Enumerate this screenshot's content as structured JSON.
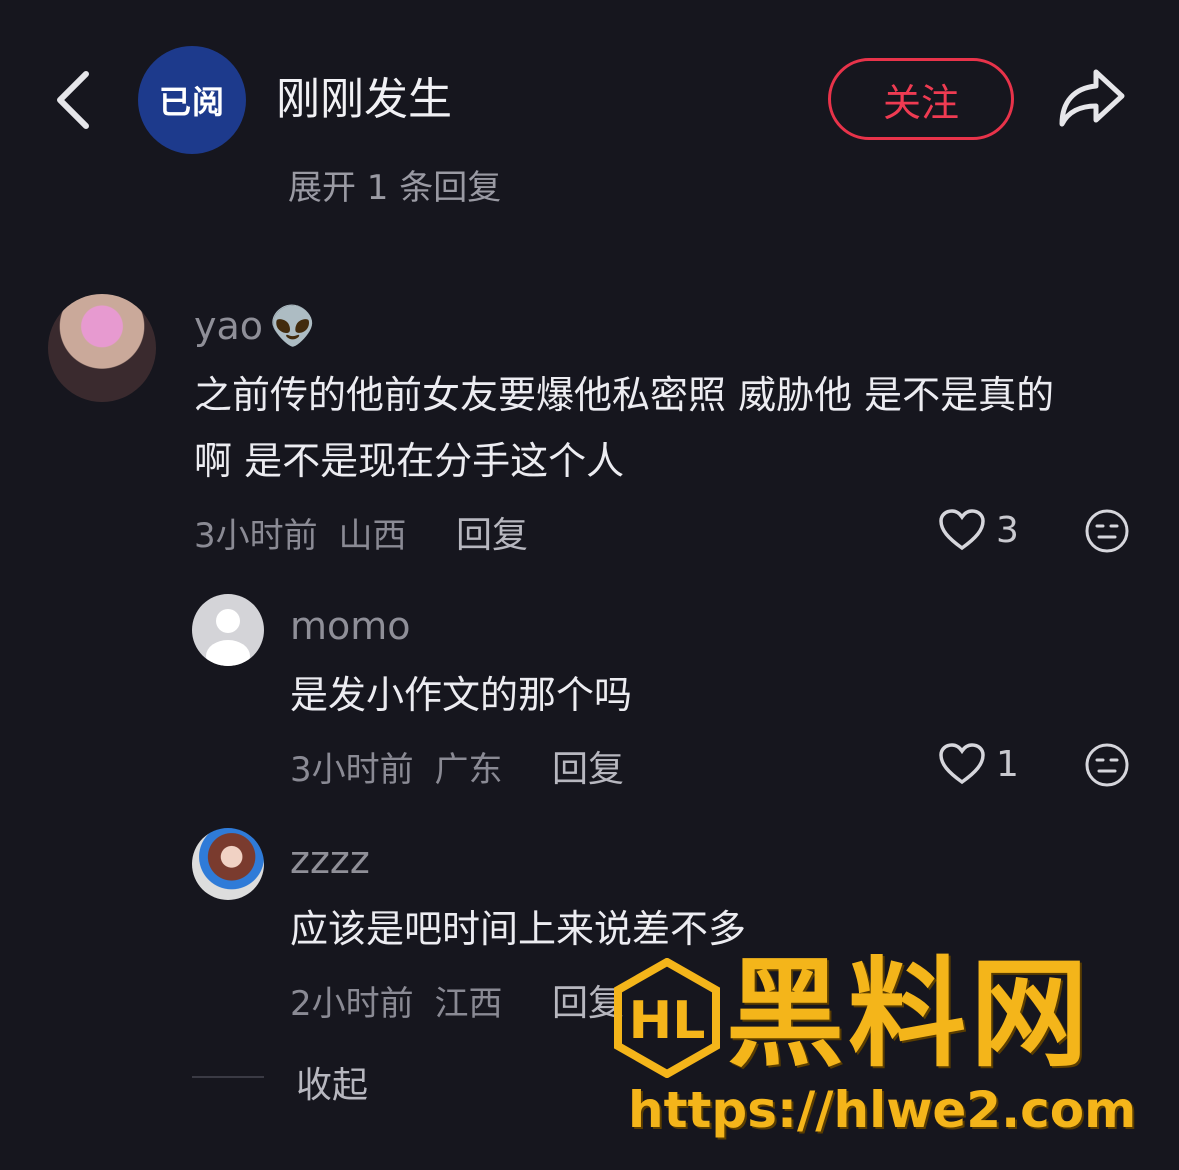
{
  "header": {
    "channel_badge": "已阅",
    "channel_name": "刚刚发生",
    "follow_label": "关注"
  },
  "expand_replies": "展开 1 条回复",
  "comments": [
    {
      "username": "yao",
      "username_emoji": "👽",
      "text_line1": "之前传的他前女友要爆他私密照 威胁他 是不是真的",
      "text_line2": "啊 是不是现在分手这个人",
      "time": "3小时前",
      "location": "山西",
      "reply_label": "回复",
      "likes": "3"
    }
  ],
  "replies": [
    {
      "username": "momo",
      "text": "是发小作文的那个吗",
      "time": "3小时前",
      "location": "广东",
      "reply_label": "回复",
      "likes": "1"
    },
    {
      "username": "zzzz",
      "text": "应该是吧时间上来说差不多",
      "time": "2小时前",
      "location": "江西",
      "reply_label": "回复"
    }
  ],
  "collapse_label": "收起",
  "watermark": {
    "brand": "黑料网",
    "logo_text": "HL",
    "url": "https://hlwe2.com"
  },
  "colors": {
    "background": "#16161e",
    "follow_red": "#e8334a",
    "channel_blue": "#1d3a8c",
    "watermark_gold": "#f4b51a"
  }
}
